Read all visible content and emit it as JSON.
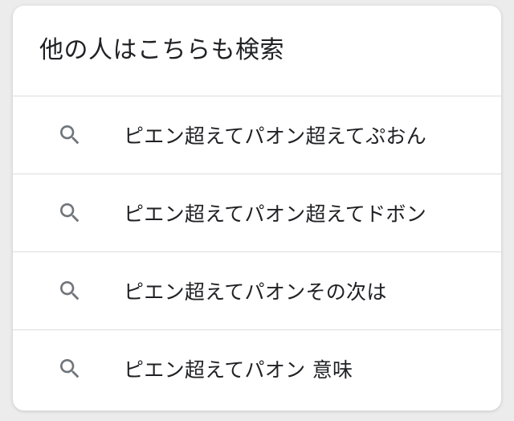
{
  "related_searches": {
    "title": "他の人はこちらも検索",
    "icon_color": "#70757a",
    "items": [
      {
        "icon": "search-icon",
        "label": "ピエン超えてパオン超えてぷおん"
      },
      {
        "icon": "search-icon",
        "label": "ピエン超えてパオン超えてドボン"
      },
      {
        "icon": "search-icon",
        "label": "ピエン超えてパオンその次は"
      },
      {
        "icon": "search-icon",
        "label": "ピエン超えてパオン 意味"
      }
    ]
  }
}
